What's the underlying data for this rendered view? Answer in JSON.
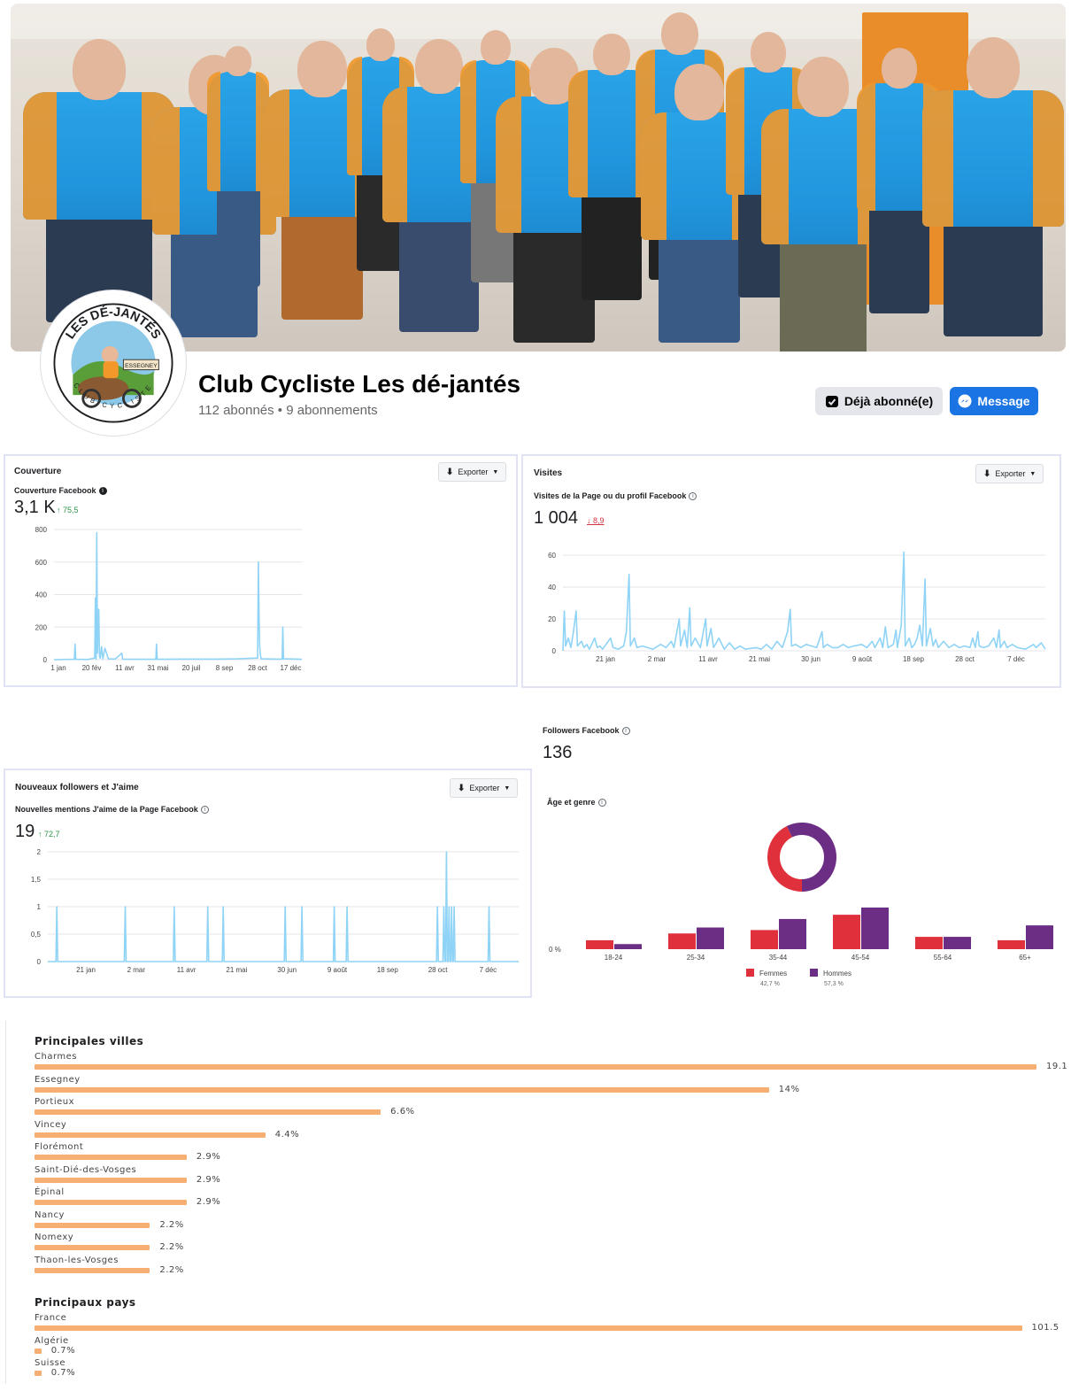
{
  "page": {
    "name": "Club Cycliste Les dé-jantés",
    "stats": "112 abonnés • 9 abonnements",
    "follow_button": "Déjà abonné(e)",
    "message_button": "Message",
    "avatar_text": {
      "top": "LES DÉ-JANTÉS",
      "sign": "ESSEGNEY",
      "bottom": "CLUB CYCLISTE"
    },
    "colors": {
      "brand_blue": "#1b74e4",
      "jersey_blue": "#2196de",
      "jersey_orange": "#f2982a"
    }
  },
  "export_label": "Exporter",
  "coverage": {
    "title": "Couverture",
    "subtitle": "Couverture Facebook",
    "value": "3,1 K",
    "delta": "↑ 75,5"
  },
  "visits": {
    "title": "Visites",
    "subtitle": "Visites de la Page ou du profil Facebook",
    "value": "1 004",
    "delta": "↓ 8,9"
  },
  "new_followers": {
    "title": "Nouveaux followers et J'aime",
    "subtitle": "Nouvelles mentions J'aime de la Page Facebook",
    "value": "19",
    "delta": "↑ 72,7"
  },
  "followers": {
    "label": "Followers Facebook",
    "value": "136",
    "age_gender_label": "Âge et genre",
    "zero_label": "0 %"
  },
  "top_cities": {
    "title": "Principales villes",
    "items": [
      {
        "label": "Charmes",
        "value": "19.1",
        "pct": 19.1
      },
      {
        "label": "Essegney",
        "value": "14%",
        "pct": 14
      },
      {
        "label": "Portieux",
        "value": "6.6%",
        "pct": 6.6
      },
      {
        "label": "Vincey",
        "value": "4.4%",
        "pct": 4.4
      },
      {
        "label": "Florémont",
        "value": "2.9%",
        "pct": 2.9
      },
      {
        "label": "Saint-Dié-des-Vosges",
        "value": "2.9%",
        "pct": 2.9
      },
      {
        "label": "Épinal",
        "value": "2.9%",
        "pct": 2.9
      },
      {
        "label": "Nancy",
        "value": "2.2%",
        "pct": 2.2
      },
      {
        "label": "Nomexy",
        "value": "2.2%",
        "pct": 2.2
      },
      {
        "label": "Thaon-les-Vosges",
        "value": "2.2%",
        "pct": 2.2
      }
    ]
  },
  "top_countries": {
    "title": "Principaux pays",
    "items": [
      {
        "label": "France",
        "value": "101.5",
        "pct": 101.5
      },
      {
        "label": "Algérie",
        "value": "0.7%",
        "pct": 0.7
      },
      {
        "label": "Suisse",
        "value": "0.7%",
        "pct": 0.7
      }
    ]
  },
  "chart_data": [
    {
      "type": "line",
      "name": "Couverture Facebook",
      "color": "#8fd3f6",
      "x_ticks": [
        "1 jan",
        "20 fév",
        "11 avr",
        "31 mai",
        "20 juil",
        "8 sep",
        "28 oct",
        "17 déc"
      ],
      "y_ticks": [
        0,
        200,
        400,
        600,
        800
      ],
      "ylim": [
        0,
        800
      ],
      "x_range": [
        0,
        365
      ],
      "points": [
        [
          0,
          0
        ],
        [
          30,
          2
        ],
        [
          31,
          95
        ],
        [
          32,
          2
        ],
        [
          50,
          1
        ],
        [
          60,
          10
        ],
        [
          61,
          380
        ],
        [
          62,
          2
        ],
        [
          63,
          780
        ],
        [
          64,
          40
        ],
        [
          65,
          200
        ],
        [
          66,
          310
        ],
        [
          67,
          20
        ],
        [
          68,
          8
        ],
        [
          70,
          80
        ],
        [
          72,
          5
        ],
        [
          75,
          70
        ],
        [
          80,
          5
        ],
        [
          90,
          3
        ],
        [
          100,
          40
        ],
        [
          101,
          3
        ],
        [
          120,
          2
        ],
        [
          130,
          2
        ],
        [
          150,
          2
        ],
        [
          151,
          95
        ],
        [
          152,
          2
        ],
        [
          180,
          3
        ],
        [
          210,
          3
        ],
        [
          240,
          3
        ],
        [
          270,
          5
        ],
        [
          300,
          10
        ],
        [
          301,
          600
        ],
        [
          302,
          260
        ],
        [
          303,
          80
        ],
        [
          304,
          30
        ],
        [
          305,
          5
        ],
        [
          330,
          3
        ],
        [
          336,
          3
        ],
        [
          337,
          200
        ],
        [
          338,
          5
        ],
        [
          365,
          2
        ]
      ]
    },
    {
      "type": "line",
      "name": "Visites de la Page ou du profil Facebook",
      "color": "#8fd3f6",
      "x_ticks": [
        "21 jan",
        "2 mar",
        "11 avr",
        "21 mai",
        "30 jun",
        "9 août",
        "18 sep",
        "28 oct",
        "7 déc"
      ],
      "y_ticks": [
        0,
        20,
        40,
        60
      ],
      "ylim": [
        0,
        60
      ],
      "x_range": [
        0,
        365
      ],
      "points": [
        [
          0,
          0
        ],
        [
          1,
          25
        ],
        [
          2,
          3
        ],
        [
          4,
          8
        ],
        [
          6,
          2
        ],
        [
          8,
          12
        ],
        [
          10,
          25
        ],
        [
          11,
          3
        ],
        [
          14,
          6
        ],
        [
          16,
          2
        ],
        [
          18,
          4
        ],
        [
          20,
          1
        ],
        [
          24,
          8
        ],
        [
          26,
          2
        ],
        [
          28,
          3
        ],
        [
          30,
          1
        ],
        [
          36,
          8
        ],
        [
          38,
          2
        ],
        [
          42,
          1
        ],
        [
          46,
          3
        ],
        [
          48,
          12
        ],
        [
          50,
          48
        ],
        [
          51,
          3
        ],
        [
          54,
          8
        ],
        [
          56,
          2
        ],
        [
          60,
          3
        ],
        [
          64,
          2
        ],
        [
          68,
          1
        ],
        [
          74,
          4
        ],
        [
          78,
          2
        ],
        [
          82,
          6
        ],
        [
          84,
          2
        ],
        [
          88,
          20
        ],
        [
          89,
          3
        ],
        [
          92,
          13
        ],
        [
          94,
          2
        ],
        [
          96,
          27
        ],
        [
          97,
          3
        ],
        [
          100,
          8
        ],
        [
          104,
          2
        ],
        [
          108,
          20
        ],
        [
          109,
          3
        ],
        [
          112,
          14
        ],
        [
          114,
          2
        ],
        [
          118,
          8
        ],
        [
          122,
          1
        ],
        [
          126,
          5
        ],
        [
          130,
          1
        ],
        [
          134,
          3
        ],
        [
          138,
          1
        ],
        [
          146,
          2
        ],
        [
          150,
          1
        ],
        [
          154,
          4
        ],
        [
          158,
          1
        ],
        [
          162,
          6
        ],
        [
          166,
          2
        ],
        [
          170,
          12
        ],
        [
          172,
          26
        ],
        [
          173,
          3
        ],
        [
          176,
          4
        ],
        [
          180,
          2
        ],
        [
          184,
          4
        ],
        [
          188,
          3
        ],
        [
          192,
          2
        ],
        [
          196,
          12
        ],
        [
          197,
          2
        ],
        [
          200,
          4
        ],
        [
          204,
          2
        ],
        [
          208,
          2
        ],
        [
          212,
          4
        ],
        [
          216,
          2
        ],
        [
          220,
          3
        ],
        [
          226,
          4
        ],
        [
          230,
          2
        ],
        [
          234,
          6
        ],
        [
          236,
          2
        ],
        [
          240,
          8
        ],
        [
          242,
          2
        ],
        [
          244,
          15
        ],
        [
          246,
          2
        ],
        [
          250,
          4
        ],
        [
          252,
          13
        ],
        [
          253,
          2
        ],
        [
          256,
          16
        ],
        [
          258,
          62
        ],
        [
          259,
          3
        ],
        [
          262,
          8
        ],
        [
          264,
          2
        ],
        [
          266,
          4
        ],
        [
          268,
          8
        ],
        [
          270,
          16
        ],
        [
          272,
          3
        ],
        [
          274,
          45
        ],
        [
          275,
          3
        ],
        [
          278,
          14
        ],
        [
          280,
          3
        ],
        [
          282,
          7
        ],
        [
          284,
          2
        ],
        [
          288,
          6
        ],
        [
          292,
          2
        ],
        [
          296,
          4
        ],
        [
          300,
          2
        ],
        [
          304,
          3
        ],
        [
          308,
          2
        ],
        [
          310,
          8
        ],
        [
          312,
          2
        ],
        [
          314,
          12
        ],
        [
          315,
          3
        ],
        [
          318,
          2
        ],
        [
          322,
          3
        ],
        [
          326,
          8
        ],
        [
          328,
          2
        ],
        [
          330,
          13
        ],
        [
          331,
          2
        ],
        [
          334,
          6
        ],
        [
          336,
          2
        ],
        [
          340,
          4
        ],
        [
          344,
          2
        ],
        [
          350,
          1
        ],
        [
          356,
          4
        ],
        [
          358,
          2
        ],
        [
          362,
          5
        ],
        [
          365,
          1
        ]
      ]
    },
    {
      "type": "line",
      "name": "Nouvelles mentions J'aime de la Page Facebook",
      "color": "#8fd3f6",
      "x_ticks": [
        "21 jan",
        "2 mar",
        "11 avr",
        "21 mai",
        "30 jun",
        "9 août",
        "18 sep",
        "28 oct",
        "7 déc"
      ],
      "y_ticks": [
        0,
        0.5,
        1,
        1.5,
        2
      ],
      "ylim": [
        0,
        2
      ],
      "x_range": [
        0,
        365
      ],
      "spikes": [
        [
          7,
          1
        ],
        [
          60,
          1
        ],
        [
          98,
          1
        ],
        [
          124,
          1
        ],
        [
          136,
          1
        ],
        [
          184,
          1
        ],
        [
          197,
          1
        ],
        [
          222,
          1
        ],
        [
          232,
          1
        ],
        [
          302,
          1
        ],
        [
          307,
          1
        ],
        [
          309,
          2
        ],
        [
          311,
          1
        ],
        [
          313,
          1
        ],
        [
          315,
          1
        ],
        [
          342,
          1
        ]
      ]
    },
    {
      "type": "pie",
      "name": "Genre",
      "donut": true,
      "slices": [
        {
          "name": "Femmes",
          "value": 42.7,
          "color": "#e0303c"
        },
        {
          "name": "Hommes",
          "value": 57.3,
          "color": "#6c2d85"
        }
      ]
    },
    {
      "type": "bar",
      "name": "Âge et genre",
      "categories": [
        "18-24",
        "25-34",
        "35-44",
        "45-54",
        "55-64",
        "65+"
      ],
      "series": [
        {
          "name": "Femmes",
          "share": "42,7 %",
          "color": "#e0303c",
          "values": [
            2.1,
            3.7,
            4.5,
            8.1,
            2.9,
            2.1
          ]
        },
        {
          "name": "Hommes",
          "share": "57,3 %",
          "color": "#6c2d85",
          "values": [
            1.2,
            5.1,
            7.1,
            9.8,
            2.9,
            5.6
          ]
        }
      ],
      "y_ticks": [
        "0 %"
      ]
    }
  ]
}
